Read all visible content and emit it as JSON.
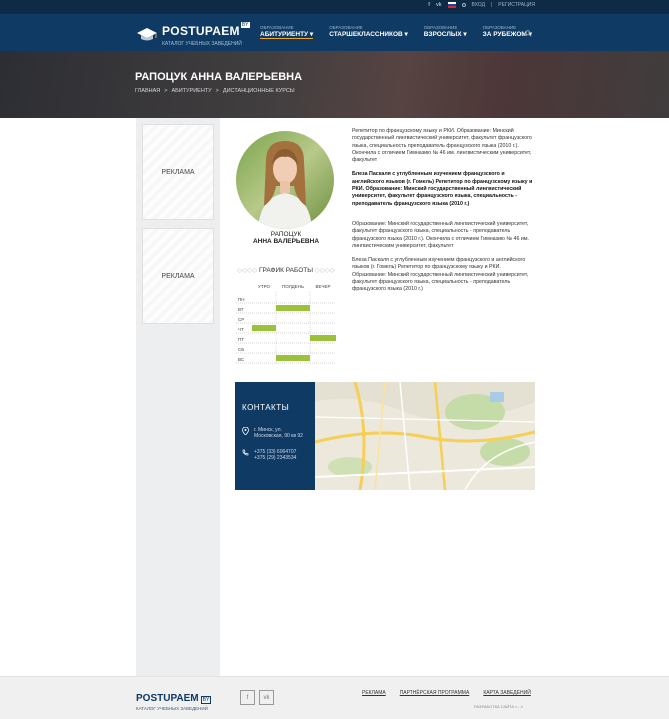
{
  "topbar": {
    "social": [
      "f",
      "vk"
    ],
    "language_flag": "ru-flag",
    "login": "ВХОД",
    "register": "РЕГИСТРАЦИЯ"
  },
  "logo": {
    "name": "POSTUPAEM",
    "by": "BY",
    "subtitle": "КАТАЛОГ УЧЕБНЫХ ЗАВЕДЕНИЙ"
  },
  "nav": [
    {
      "small": "ОБРАЗОВАНИЕ",
      "big": "АБИТУРИЕНТУ",
      "active": true
    },
    {
      "small": "ОБРАЗОВАНИЕ",
      "big": "СТАРШЕКЛАССНИКОВ",
      "active": false
    },
    {
      "small": "ОБРАЗОВАНИЕ",
      "big": "ВЗРОСЛЫХ",
      "active": false
    },
    {
      "small": "ОБРАЗОВАНИЕ",
      "big": "ЗА РУБЕЖОМ",
      "active": false
    }
  ],
  "hero": {
    "title": "РАПОЦУК АННА ВАЛЕРЬЕВНА",
    "breadcrumbs": [
      "ГЛАВНАЯ",
      ">",
      "АБИТУРИЕНТУ",
      ">",
      "ДИСТАНЦИОННЫЕ КУРСЫ"
    ]
  },
  "ads": [
    "РЕКЛАМА",
    "РЕКЛАМА"
  ],
  "profile": {
    "surname": "РАПОЦУК",
    "name": "АННА ВАЛЕРЬЕВНА"
  },
  "schedule": {
    "title": "ГРАФИК РАБОТЫ",
    "columns": [
      "УТРО",
      "ПОЛДЕНЬ",
      "ВЕЧЕР"
    ],
    "days": [
      "ПН",
      "ВТ",
      "СР",
      "ЧТ",
      "ПТ",
      "СБ",
      "ВС"
    ],
    "active_slots": [
      {
        "day": 1,
        "slot": 1
      },
      {
        "day": 3,
        "slot": 0
      },
      {
        "day": 4,
        "slot": 2
      },
      {
        "day": 6,
        "slot": 1
      }
    ],
    "color": "#9cc13b"
  },
  "bio": [
    {
      "bold": false,
      "text": "Репетитор по французскому языку и РКИ. Образование: Минский государственный лингвистический университет, факультет французского языка, специальность преподаватель французского языка (2010 г.). Окончила с отличием Гимназию № 46 им. лингвистическим университет, факультет"
    },
    {
      "bold": true,
      "text": "Блеза Паскаля с углубленным изучением французского и английского языков (г. Гомель) Репетитор по французскому языку и РКИ. Образование: Минский государственный лингвистический университет, факультет французского языка, специальность - преподаватель французского языка (2010 г.)"
    },
    {
      "bold": false,
      "text": "Образование: Минский государственный лингвистический университет, факультет французского языка, специальность - преподаватель французского языка (2010 г.). Окончила с отличием Гимназию № 46 им. лингвистическим университет, факультет"
    },
    {
      "bold": false,
      "text": "Блеза Паскаля с углубленным изучением французского и английского языков (г. Гомель) Репетитор по французскому языку и РКИ. Образование: Минский государственный лингвистический университет, факультет французского языка, специальность - преподаватель французского языка (2010 г.)"
    }
  ],
  "contacts": {
    "title": "КОНТАКТЫ",
    "address": [
      "г. Минск, ул.",
      "Московская, 90 кв 92"
    ],
    "phones": [
      "+375 (33) 6064707",
      "+375 (29) 2343534"
    ]
  },
  "footer": {
    "logo_name": "POSTUPAEM",
    "logo_by": "BY",
    "logo_sub": "КАТАЛОГ УЧЕБНЫХ ЗАВЕДЕНИЙ",
    "social": [
      "f",
      "vk"
    ],
    "links": [
      "РЕКЛАМА",
      "ПАРТНЁРСКАЯ ПРОГРАММА",
      "КАРТА ЗАВЕДЕНИЙ"
    ],
    "copyright": "РАЗРАБОТКА САЙТА «...»"
  }
}
